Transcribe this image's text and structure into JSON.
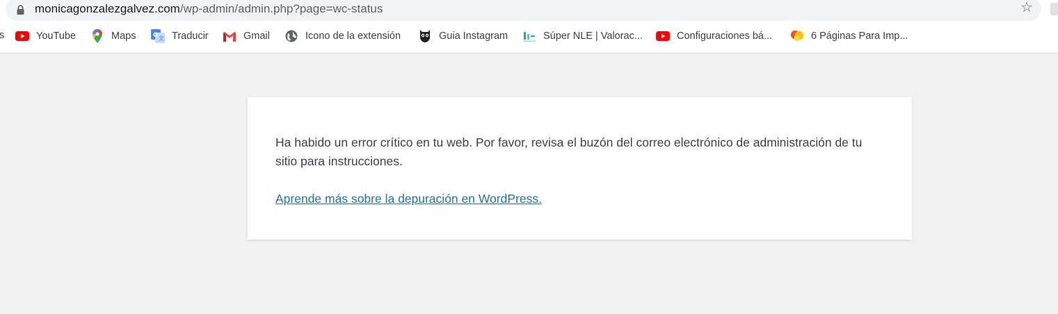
{
  "browser": {
    "url_host": "monicagonzalezgalvez.com",
    "url_path": "/wp-admin/admin.php?page=wc-status",
    "bookmarks_partial": "s",
    "bookmarks": [
      {
        "label": "YouTube",
        "icon": "youtube-icon"
      },
      {
        "label": "Maps",
        "icon": "maps-pin-icon"
      },
      {
        "label": "Traducir",
        "icon": "translate-icon"
      },
      {
        "label": "Gmail",
        "icon": "gmail-icon"
      },
      {
        "label": "Icono de la extensión",
        "icon": "globe-icon"
      },
      {
        "label": "Guia Instagram",
        "icon": "owl-icon"
      },
      {
        "label": "Súper NLE | Valorac...",
        "icon": "nle-logo-icon"
      },
      {
        "label": "Configuraciones bá...",
        "icon": "youtube-icon"
      },
      {
        "label": "6 Páginas Para Imp...",
        "icon": "circles-icon"
      }
    ]
  },
  "error_page": {
    "message": "Ha habido un error crítico en tu web. Por favor, revisa el buzón del correo electrónico de administración de tu sitio para instrucciones.",
    "link_text": "Aprende más sobre la depuración en WordPress."
  },
  "colors": {
    "page_background": "#f1f1f1",
    "card_background": "#ffffff",
    "link": "#2271b1",
    "text": "#3c434a"
  }
}
